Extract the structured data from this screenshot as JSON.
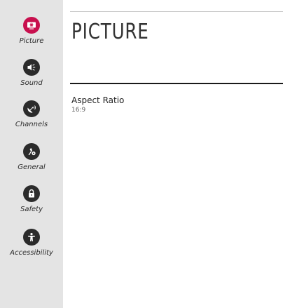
{
  "sidebar": {
    "items": [
      {
        "label": "Picture",
        "icon": "picture-icon",
        "active": true
      },
      {
        "label": "Sound",
        "icon": "sound-icon",
        "active": false
      },
      {
        "label": "Channels",
        "icon": "channels-icon",
        "active": false
      },
      {
        "label": "General",
        "icon": "general-icon",
        "active": false
      },
      {
        "label": "Safety",
        "icon": "safety-icon",
        "active": false
      },
      {
        "label": "Accessibility",
        "icon": "accessibility-icon",
        "active": false
      }
    ]
  },
  "main": {
    "title": "PICTURE",
    "settings": [
      {
        "label": "Aspect Ratio",
        "value": "16:9"
      }
    ]
  },
  "colors": {
    "accent": "#c8104e",
    "sidebar_bg": "#e4e4e4",
    "icon_dark": "#2b2b2b"
  }
}
